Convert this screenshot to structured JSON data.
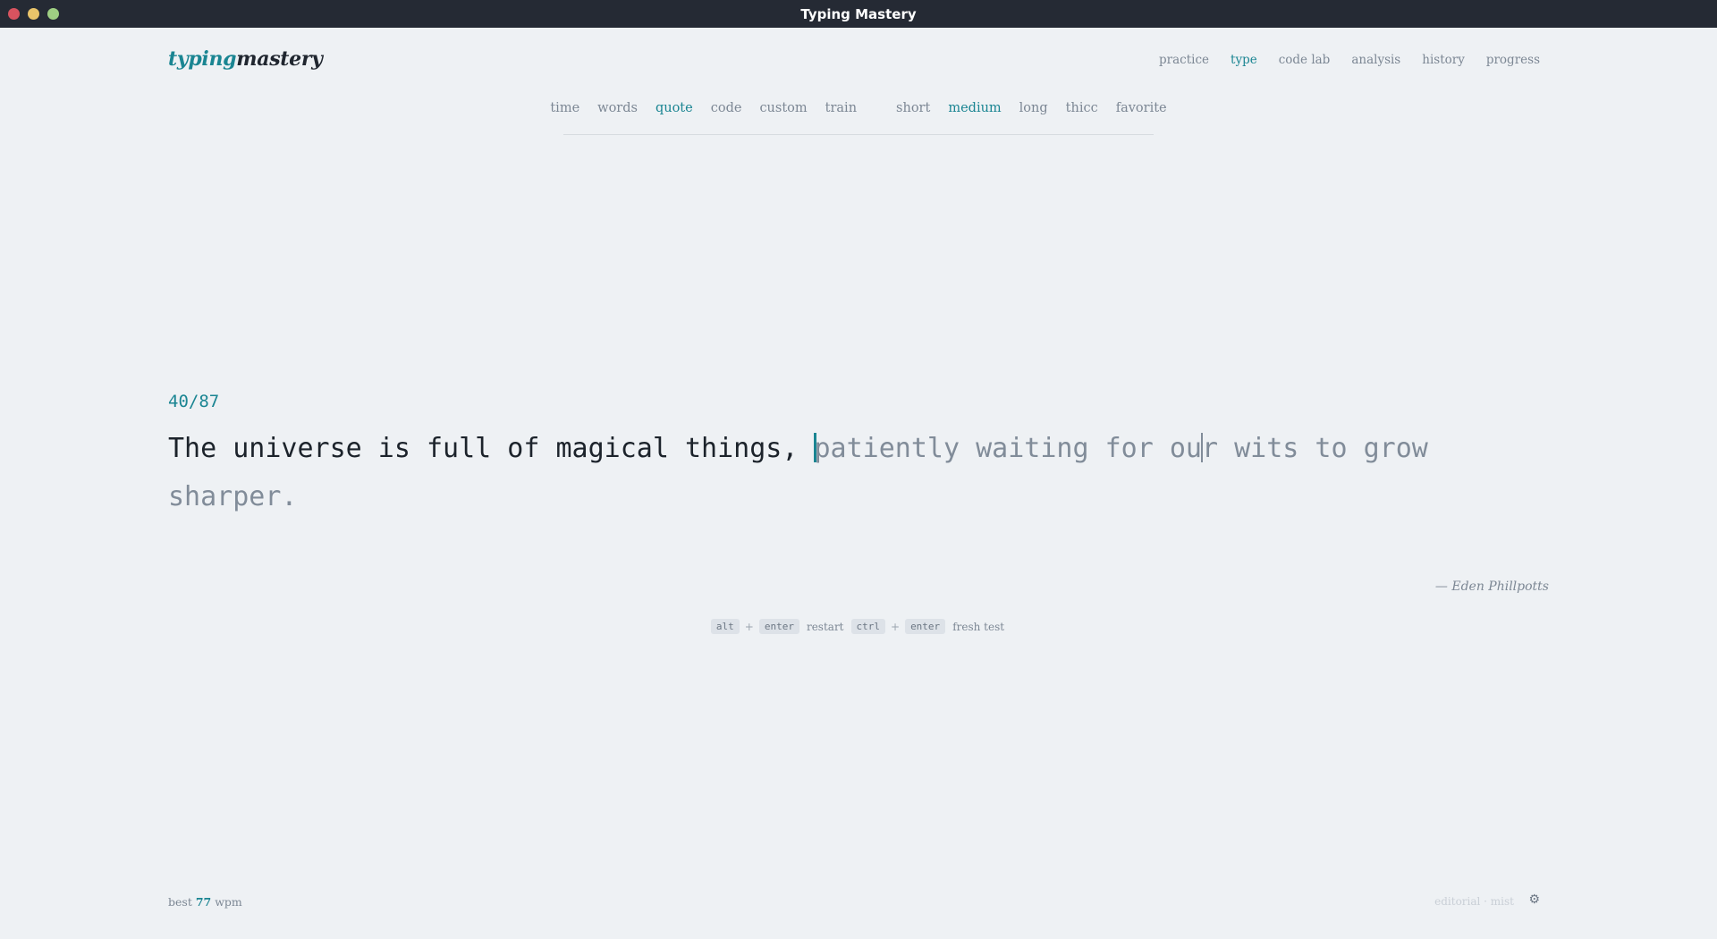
{
  "window": {
    "title": "Typing Mastery"
  },
  "logo": {
    "part1": "typing",
    "part2": "mastery"
  },
  "topnav": {
    "items": [
      {
        "label": "practice",
        "active": false
      },
      {
        "label": "type",
        "active": true
      },
      {
        "label": "code lab",
        "active": false
      },
      {
        "label": "analysis",
        "active": false
      },
      {
        "label": "history",
        "active": false
      },
      {
        "label": "progress",
        "active": false
      }
    ]
  },
  "modes": {
    "types": [
      {
        "label": "time",
        "active": false
      },
      {
        "label": "words",
        "active": false
      },
      {
        "label": "quote",
        "active": true
      },
      {
        "label": "code",
        "active": false
      },
      {
        "label": "custom",
        "active": false
      },
      {
        "label": "train",
        "active": false
      }
    ],
    "lengths": [
      {
        "label": "short",
        "active": false
      },
      {
        "label": "medium",
        "active": true
      },
      {
        "label": "long",
        "active": false
      },
      {
        "label": "thicc",
        "active": false
      },
      {
        "label": "favorite",
        "active": false
      }
    ]
  },
  "test": {
    "progress": "40/87",
    "typed": "The universe is full of magical things, ",
    "pending_a": "patiently waiting for ou",
    "pending_b": "r wits to grow sharper.",
    "author": "— Eden Phillpotts"
  },
  "hints": {
    "alt": "alt",
    "plus": "+",
    "enter": "enter",
    "restart": "restart",
    "ctrl": "ctrl",
    "fresh": "fresh test"
  },
  "footer": {
    "best_prefix": "best",
    "best_value": "77",
    "best_unit": "wpm",
    "theme": "editorial · mist",
    "settings_icon": "gear-icon"
  },
  "colors": {
    "accent": "#1a8592",
    "background": "#eef1f4",
    "titlebar": "#252a34"
  }
}
